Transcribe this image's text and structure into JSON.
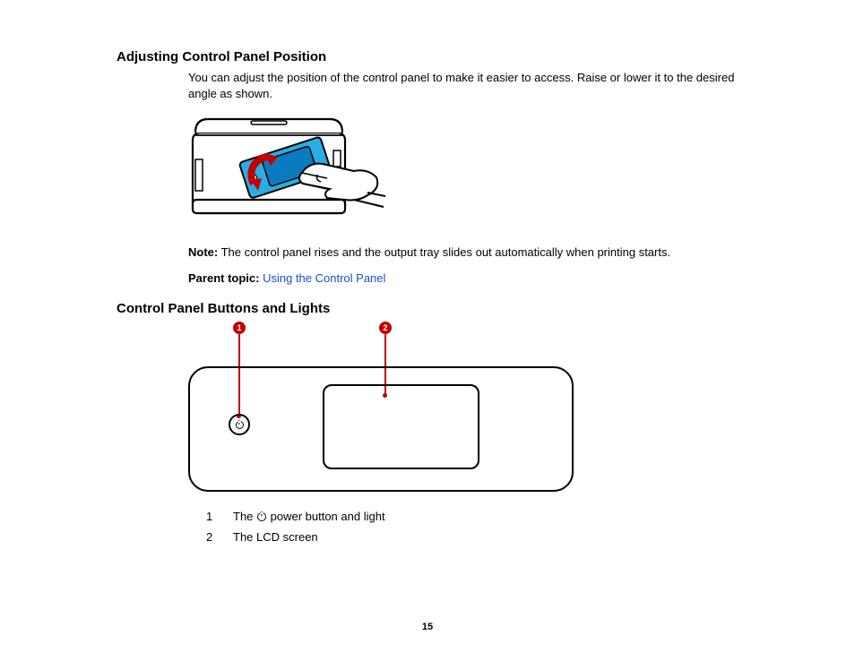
{
  "section1": {
    "heading": "Adjusting Control Panel Position",
    "body": "You can adjust the position of the control panel to make it easier to access. Raise or lower it to the desired angle as shown.",
    "note_label": "Note:",
    "note_body": " The control panel rises and the output tray slides out automatically when printing starts.",
    "parent_label": "Parent topic:",
    "parent_link": "Using the Control Panel"
  },
  "section2": {
    "heading": "Control Panel Buttons and Lights",
    "callouts": {
      "c1": "1",
      "c2": "2"
    },
    "legend": [
      {
        "num": "1",
        "prefix": "The ",
        "suffix": " power button and light",
        "has_icon": true
      },
      {
        "num": "2",
        "prefix": "The LCD screen",
        "suffix": "",
        "has_icon": false
      }
    ]
  },
  "page_number": "15"
}
